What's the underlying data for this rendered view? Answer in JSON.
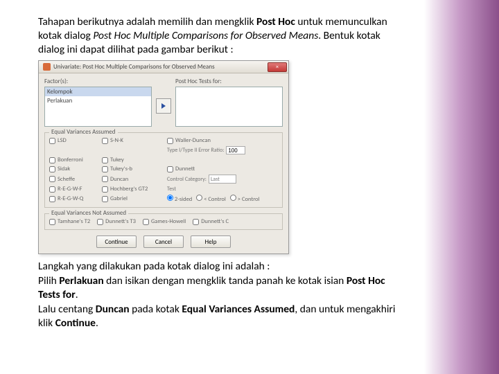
{
  "intro": {
    "t1": "Tahapan berikutnya adalah memilih dan mengklik ",
    "posthoc": "Post Hoc",
    "t2": " untuk memunculkan kotak dialog  ",
    "dlgname": "Post Hoc Multiple Comparisons for Observed Means",
    "t3": ". Bentuk kotak dialog ini dapat dilihat pada gambar berikut :"
  },
  "dialog": {
    "title": "Univariate: Post Hoc Multiple Comparisons for Observed Means",
    "closeX": "×",
    "factorsLabel": "Factor(s):",
    "factors": [
      "Kelompok",
      "Perlakuan"
    ],
    "testsForLabel": "Post Hoc Tests for:",
    "group1Label": "Equal Variances Assumed",
    "opts": {
      "lsd": "LSD",
      "snk": "S-N-K",
      "waller": "Waller-Duncan",
      "typeratio": "Type I/Type II Error Ratio:",
      "typeratioVal": "100",
      "bonf": "Bonferroni",
      "tukey": "Tukey",
      "sidak": "Sidak",
      "tukeyb": "Tukey's-b",
      "dunnett": "Dunnett",
      "scheffe": "Scheffe",
      "duncan": "Duncan",
      "ctrlcat": "Control Category:",
      "ctrlcatVal": "Last",
      "regwf": "R-E-G-W-F",
      "hoch": "Hochberg's GT2",
      "testLabel": "Test",
      "regwq": "R-E-G-W-Q",
      "gabriel": "Gabriel",
      "r2sided": "2-sided",
      "rlt": "< Control",
      "rgt": "> Control"
    },
    "group2Label": "Equal Variances Not Assumed",
    "neq": {
      "t2": "Tamhane's T2",
      "t3": "Dunnett's T3",
      "gh": "Games-Howell",
      "c": "Dunnett's C"
    },
    "buttons": {
      "continue": "Continue",
      "cancel": "Cancel",
      "help": "Help"
    }
  },
  "outro": {
    "l1": "Langkah yang dilakukan pada kotak dialog ini adalah :",
    "l2a": "Pilih ",
    "l2b": "Perlakuan",
    "l2c": " dan isikan dengan mengklik tanda panah ke kotak isian ",
    "l2d": "Post Hoc Tests for",
    "l2e": ".",
    "l3a": "Lalu centang ",
    "l3b": "Duncan",
    "l3c": " pada kotak ",
    "l3d": "Equal Variances Assumed",
    "l3e": ", dan untuk mengakhiri klik ",
    "l3f": "Continue",
    "l3g": "."
  }
}
